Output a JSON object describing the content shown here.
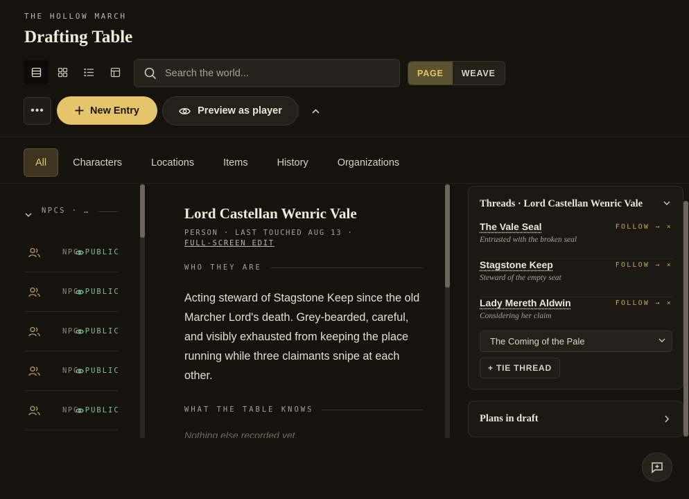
{
  "header": {
    "eyebrow": "THE HOLLOW MARCH",
    "title": "Drafting Table"
  },
  "toolbar": {
    "views": [
      {
        "name": "list-view-icon",
        "active": true
      },
      {
        "name": "grid-view-icon",
        "active": false
      },
      {
        "name": "outline-view-icon",
        "active": false
      },
      {
        "name": "table-view-icon",
        "active": false
      }
    ],
    "search_placeholder": "Search the world...",
    "modes": {
      "page": "PAGE",
      "weave": "WEAVE",
      "active": "page"
    },
    "more_label": "•••",
    "new_entry_label": "New Entry",
    "preview_label": "Preview as player"
  },
  "tabs": [
    {
      "label": "All",
      "active": true
    },
    {
      "label": "Characters",
      "active": false
    },
    {
      "label": "Locations",
      "active": false
    },
    {
      "label": "Items",
      "active": false
    },
    {
      "label": "History",
      "active": false
    },
    {
      "label": "Organizations",
      "active": false
    }
  ],
  "list": {
    "group_label": "NPCS · …",
    "items": [
      {
        "type": "NPC",
        "visibility": "PUBLIC"
      },
      {
        "type": "NPC",
        "visibility": "PUBLIC"
      },
      {
        "type": "NPC",
        "visibility": "PUBLIC"
      },
      {
        "type": "NPC",
        "visibility": "PUBLIC"
      },
      {
        "type": "NPC",
        "visibility": "PUBLIC"
      }
    ]
  },
  "article": {
    "title": "Lord Castellan Wenric Vale",
    "meta": "PERSON · LAST TOUCHED AUG 13 ·",
    "edit_link": "FULL-SCREEN EDIT",
    "section1": "WHO THEY ARE",
    "body": "Acting steward of Stagstone Keep since the old Marcher Lord's death. Grey-bearded, careful, and visibly exhausted from keeping the place running while three claimants snipe at each other.",
    "section2": "WHAT THE TABLE KNOWS",
    "empty": "Nothing else recorded yet."
  },
  "threads": {
    "title": "Threads · Lord Castellan Wenric Vale",
    "follow_label": "FOLLOW → ×",
    "items": [
      {
        "name": "The Vale Seal",
        "sub": "Entrusted with the broken seal"
      },
      {
        "name": "Stagstone Keep",
        "sub": "Steward of the empty seat"
      },
      {
        "name": "Lady Mereth Aldwin",
        "sub": "Considering her claim"
      }
    ],
    "select_value": "The Coming of the Pale",
    "tie_label": "+ TIE THREAD"
  },
  "plans": {
    "title": "Plans in draft"
  },
  "colors": {
    "accent": "#e5c46a",
    "public": "#7fc38f",
    "background": "#16130f"
  }
}
